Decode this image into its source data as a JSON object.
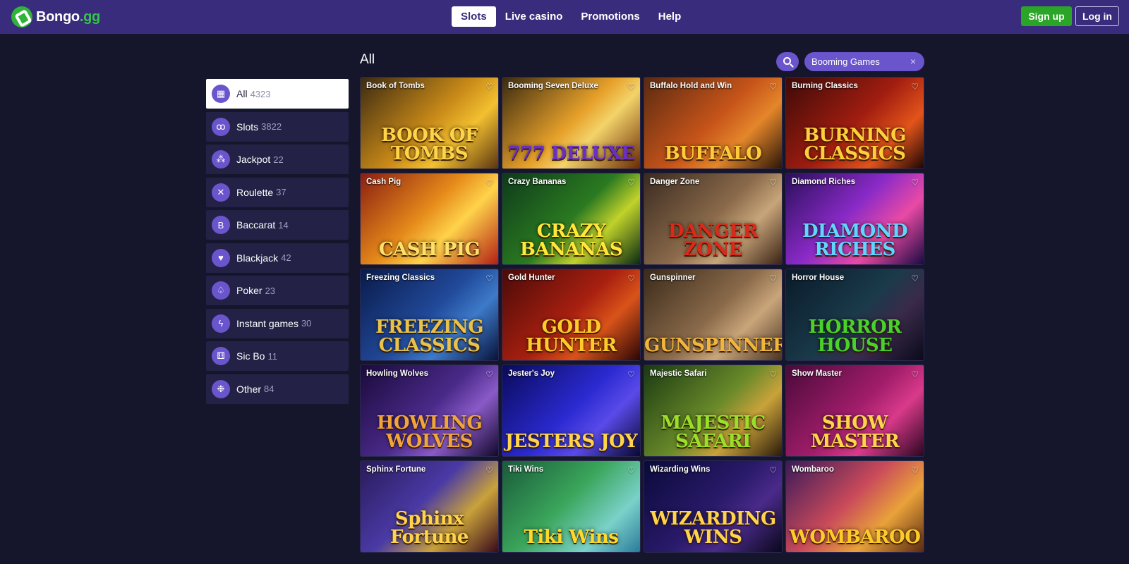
{
  "brand": {
    "name": "Bongo",
    "tld": ".gg"
  },
  "nav": [
    {
      "label": "Slots",
      "active": true
    },
    {
      "label": "Live casino"
    },
    {
      "label": "Promotions"
    },
    {
      "label": "Help"
    }
  ],
  "auth": {
    "signup": "Sign up",
    "login": "Log in"
  },
  "main": {
    "title": "All"
  },
  "filter": {
    "value": "Booming Games",
    "clear": "×"
  },
  "categories": [
    {
      "label": "All",
      "count": "4323",
      "icon": "grid-icon",
      "active": true
    },
    {
      "label": "Slots",
      "count": "3822",
      "icon": "cherries-icon"
    },
    {
      "label": "Jackpot",
      "count": "22",
      "icon": "jackpot-icon"
    },
    {
      "label": "Roulette",
      "count": "37",
      "icon": "roulette-icon"
    },
    {
      "label": "Baccarat",
      "count": "14",
      "icon": "baccarat-icon"
    },
    {
      "label": "Blackjack",
      "count": "42",
      "icon": "cards-icon"
    },
    {
      "label": "Poker",
      "count": "23",
      "icon": "spade-icon"
    },
    {
      "label": "Instant games",
      "count": "30",
      "icon": "lightning-icon"
    },
    {
      "label": "Sic Bo",
      "count": "11",
      "icon": "dice-icon"
    },
    {
      "label": "Other",
      "count": "84",
      "icon": "other-icon"
    }
  ],
  "games": [
    {
      "name": "Book of Tombs",
      "art": "BOOK OF TOMBS",
      "bg": "linear-gradient(135deg,#3b2a12,#c98a18 50%,#f2c030 70%,#5a3510)",
      "fg": "#ffd34a"
    },
    {
      "name": "Booming Seven Deluxe",
      "art": "777 DELUXE",
      "bg": "linear-gradient(135deg,#3a2a10,#e7a12a 50%,#f3d36a 65%,#6a2a05)",
      "fg": "#6b2fc4"
    },
    {
      "name": "Buffalo Hold and Win",
      "art": "BUFFALO",
      "bg": "linear-gradient(135deg,#5a2a10,#c7541a 50%,#e4862a 70%,#2a1608)",
      "fg": "#ffcb3a"
    },
    {
      "name": "Burning Classics",
      "art": "BURNING CLASSICS",
      "bg": "linear-gradient(135deg,#3d0a08,#a11d10 50%,#e2541a 75%,#1b0604)",
      "fg": "#ffce3b"
    },
    {
      "name": "Cash Pig",
      "art": "CASH PIG",
      "bg": "linear-gradient(135deg,#8a1d12,#e58a1a 45%,#ffd34a 65%,#b21f15)",
      "fg": "#ffe06a"
    },
    {
      "name": "Crazy Bananas",
      "art": "CRAZY BANANAS",
      "bg": "linear-gradient(135deg,#0d3a1a,#2b7a21 50%,#c0d22a 70%,#0a2a12)",
      "fg": "#ffe83a"
    },
    {
      "name": "Danger Zone",
      "art": "DANGER ZONE",
      "bg": "linear-gradient(135deg,#3a2a20,#8a6a4a 50%,#c7a57a 70%,#3a2214)",
      "fg": "#d92a1a"
    },
    {
      "name": "Diamond Riches",
      "art": "DIAMOND RICHES",
      "bg": "linear-gradient(135deg,#2a0f5a,#8a2ac7 45%,#e94aa5 70%,#1a0a40)",
      "fg": "#5fd6ff"
    },
    {
      "name": "Freezing Classics",
      "art": "FREEZING CLASSICS",
      "bg": "linear-gradient(135deg,#0a1a4a,#214a9a 50%,#3d7ac9 70%,#08123a)",
      "fg": "#e8c24a"
    },
    {
      "name": "Gold Hunter",
      "art": "GOLD HUNTER",
      "bg": "linear-gradient(135deg,#4a0a08,#a82010 50%,#d9531a 70%,#2a0604)",
      "fg": "#ffcb2a"
    },
    {
      "name": "Gunspinner",
      "art": "GUNSPINNER",
      "bg": "linear-gradient(135deg,#3a2a1a,#8a6a4a 50%,#c9a57a 70%,#4a3422)",
      "fg": "#f0b53a"
    },
    {
      "name": "Horror House",
      "art": "HORROR HOUSE",
      "bg": "linear-gradient(135deg,#0a1a2a,#1a3a4a 50%,#3a2a4a 70%,#0a0a1a)",
      "fg": "#4ad12a"
    },
    {
      "name": "Howling Wolves",
      "art": "HOWLING WOLVES",
      "bg": "linear-gradient(135deg,#1a0a3a,#4a2a8a 50%,#8a5ac7 70%,#12082a)",
      "fg": "#f0a53a"
    },
    {
      "name": "Jester's Joy",
      "art": "JESTERS JOY",
      "bg": "linear-gradient(135deg,#0a0a5a,#2a2ad1 50%,#5a4ae9 70%,#080830)",
      "fg": "#ffd34a"
    },
    {
      "name": "Majestic Safari",
      "art": "MAJESTIC SAFARI",
      "bg": "linear-gradient(135deg,#1a3a12,#6a8a2a 50%,#c9a23a 70%,#2a1a0a)",
      "fg": "#9ae02a"
    },
    {
      "name": "Show Master",
      "art": "SHOW MASTER",
      "bg": "linear-gradient(135deg,#4a0a3a,#a11d6a 50%,#d93a8a 70%,#2a0620)",
      "fg": "#ffd34a"
    },
    {
      "name": "Sphinx Fortune",
      "art": "Sphinx Fortune",
      "bg": "linear-gradient(135deg,#2a1a5a,#4a3aa5 45%,#c9a23a 70%,#3a0a1a)",
      "fg": "#ffd34a"
    },
    {
      "name": "Tiki Wins",
      "art": "Tiki Wins",
      "bg": "linear-gradient(135deg,#1a5a3a,#3aa55a 45%,#7ad1c9 75%,#2a7a9a)",
      "fg": "#ffd82a"
    },
    {
      "name": "Wizarding Wins",
      "art": "WIZARDING WINS",
      "bg": "linear-gradient(135deg,#0a0a3a,#2a1a6a 50%,#4a2a8a 70%,#0a081a)",
      "fg": "#ffd34a"
    },
    {
      "name": "Wombaroo",
      "art": "WOMBAROO",
      "bg": "linear-gradient(135deg,#3a1a5a,#c94a5a 45%,#e9a23a 70%,#5a2a12)",
      "fg": "#ffcb2a"
    }
  ],
  "colors": {
    "header_bg": "#3a2c7c",
    "page_bg": "#15152b",
    "accent": "#6a55cc",
    "signup": "#2aa527"
  }
}
